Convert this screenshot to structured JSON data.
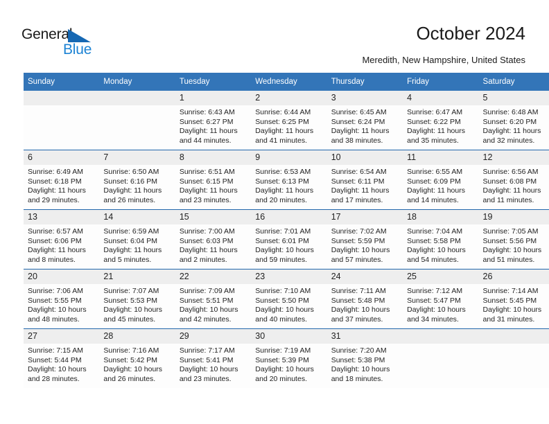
{
  "brand": {
    "name_top": "General",
    "name_bottom": "Blue",
    "triangle_icon": "blue-triangle-icon",
    "color_primary": "#1d83d4",
    "color_triangle": "#1668b3"
  },
  "header": {
    "title": "October 2024",
    "subtitle": "Meredith, New Hampshire, United States"
  },
  "calendar": {
    "header_bg": "#3375b8",
    "row_divider": "#2166ab",
    "daynum_bg": "#eeeeee",
    "weekdays": [
      "Sunday",
      "Monday",
      "Tuesday",
      "Wednesday",
      "Thursday",
      "Friday",
      "Saturday"
    ],
    "labels": {
      "sunrise": "Sunrise:",
      "sunset": "Sunset:",
      "daylight": "Daylight:"
    },
    "weeks": [
      [
        {
          "day": ""
        },
        {
          "day": ""
        },
        {
          "day": "1",
          "sunrise": "Sunrise: 6:43 AM",
          "sunset": "Sunset: 6:27 PM",
          "daylight": "Daylight: 11 hours and 44 minutes."
        },
        {
          "day": "2",
          "sunrise": "Sunrise: 6:44 AM",
          "sunset": "Sunset: 6:25 PM",
          "daylight": "Daylight: 11 hours and 41 minutes."
        },
        {
          "day": "3",
          "sunrise": "Sunrise: 6:45 AM",
          "sunset": "Sunset: 6:24 PM",
          "daylight": "Daylight: 11 hours and 38 minutes."
        },
        {
          "day": "4",
          "sunrise": "Sunrise: 6:47 AM",
          "sunset": "Sunset: 6:22 PM",
          "daylight": "Daylight: 11 hours and 35 minutes."
        },
        {
          "day": "5",
          "sunrise": "Sunrise: 6:48 AM",
          "sunset": "Sunset: 6:20 PM",
          "daylight": "Daylight: 11 hours and 32 minutes."
        }
      ],
      [
        {
          "day": "6",
          "sunrise": "Sunrise: 6:49 AM",
          "sunset": "Sunset: 6:18 PM",
          "daylight": "Daylight: 11 hours and 29 minutes."
        },
        {
          "day": "7",
          "sunrise": "Sunrise: 6:50 AM",
          "sunset": "Sunset: 6:16 PM",
          "daylight": "Daylight: 11 hours and 26 minutes."
        },
        {
          "day": "8",
          "sunrise": "Sunrise: 6:51 AM",
          "sunset": "Sunset: 6:15 PM",
          "daylight": "Daylight: 11 hours and 23 minutes."
        },
        {
          "day": "9",
          "sunrise": "Sunrise: 6:53 AM",
          "sunset": "Sunset: 6:13 PM",
          "daylight": "Daylight: 11 hours and 20 minutes."
        },
        {
          "day": "10",
          "sunrise": "Sunrise: 6:54 AM",
          "sunset": "Sunset: 6:11 PM",
          "daylight": "Daylight: 11 hours and 17 minutes."
        },
        {
          "day": "11",
          "sunrise": "Sunrise: 6:55 AM",
          "sunset": "Sunset: 6:09 PM",
          "daylight": "Daylight: 11 hours and 14 minutes."
        },
        {
          "day": "12",
          "sunrise": "Sunrise: 6:56 AM",
          "sunset": "Sunset: 6:08 PM",
          "daylight": "Daylight: 11 hours and 11 minutes."
        }
      ],
      [
        {
          "day": "13",
          "sunrise": "Sunrise: 6:57 AM",
          "sunset": "Sunset: 6:06 PM",
          "daylight": "Daylight: 11 hours and 8 minutes."
        },
        {
          "day": "14",
          "sunrise": "Sunrise: 6:59 AM",
          "sunset": "Sunset: 6:04 PM",
          "daylight": "Daylight: 11 hours and 5 minutes."
        },
        {
          "day": "15",
          "sunrise": "Sunrise: 7:00 AM",
          "sunset": "Sunset: 6:03 PM",
          "daylight": "Daylight: 11 hours and 2 minutes."
        },
        {
          "day": "16",
          "sunrise": "Sunrise: 7:01 AM",
          "sunset": "Sunset: 6:01 PM",
          "daylight": "Daylight: 10 hours and 59 minutes."
        },
        {
          "day": "17",
          "sunrise": "Sunrise: 7:02 AM",
          "sunset": "Sunset: 5:59 PM",
          "daylight": "Daylight: 10 hours and 57 minutes."
        },
        {
          "day": "18",
          "sunrise": "Sunrise: 7:04 AM",
          "sunset": "Sunset: 5:58 PM",
          "daylight": "Daylight: 10 hours and 54 minutes."
        },
        {
          "day": "19",
          "sunrise": "Sunrise: 7:05 AM",
          "sunset": "Sunset: 5:56 PM",
          "daylight": "Daylight: 10 hours and 51 minutes."
        }
      ],
      [
        {
          "day": "20",
          "sunrise": "Sunrise: 7:06 AM",
          "sunset": "Sunset: 5:55 PM",
          "daylight": "Daylight: 10 hours and 48 minutes."
        },
        {
          "day": "21",
          "sunrise": "Sunrise: 7:07 AM",
          "sunset": "Sunset: 5:53 PM",
          "daylight": "Daylight: 10 hours and 45 minutes."
        },
        {
          "day": "22",
          "sunrise": "Sunrise: 7:09 AM",
          "sunset": "Sunset: 5:51 PM",
          "daylight": "Daylight: 10 hours and 42 minutes."
        },
        {
          "day": "23",
          "sunrise": "Sunrise: 7:10 AM",
          "sunset": "Sunset: 5:50 PM",
          "daylight": "Daylight: 10 hours and 40 minutes."
        },
        {
          "day": "24",
          "sunrise": "Sunrise: 7:11 AM",
          "sunset": "Sunset: 5:48 PM",
          "daylight": "Daylight: 10 hours and 37 minutes."
        },
        {
          "day": "25",
          "sunrise": "Sunrise: 7:12 AM",
          "sunset": "Sunset: 5:47 PM",
          "daylight": "Daylight: 10 hours and 34 minutes."
        },
        {
          "day": "26",
          "sunrise": "Sunrise: 7:14 AM",
          "sunset": "Sunset: 5:45 PM",
          "daylight": "Daylight: 10 hours and 31 minutes."
        }
      ],
      [
        {
          "day": "27",
          "sunrise": "Sunrise: 7:15 AM",
          "sunset": "Sunset: 5:44 PM",
          "daylight": "Daylight: 10 hours and 28 minutes."
        },
        {
          "day": "28",
          "sunrise": "Sunrise: 7:16 AM",
          "sunset": "Sunset: 5:42 PM",
          "daylight": "Daylight: 10 hours and 26 minutes."
        },
        {
          "day": "29",
          "sunrise": "Sunrise: 7:17 AM",
          "sunset": "Sunset: 5:41 PM",
          "daylight": "Daylight: 10 hours and 23 minutes."
        },
        {
          "day": "30",
          "sunrise": "Sunrise: 7:19 AM",
          "sunset": "Sunset: 5:39 PM",
          "daylight": "Daylight: 10 hours and 20 minutes."
        },
        {
          "day": "31",
          "sunrise": "Sunrise: 7:20 AM",
          "sunset": "Sunset: 5:38 PM",
          "daylight": "Daylight: 10 hours and 18 minutes."
        },
        {
          "day": ""
        },
        {
          "day": ""
        }
      ]
    ]
  }
}
